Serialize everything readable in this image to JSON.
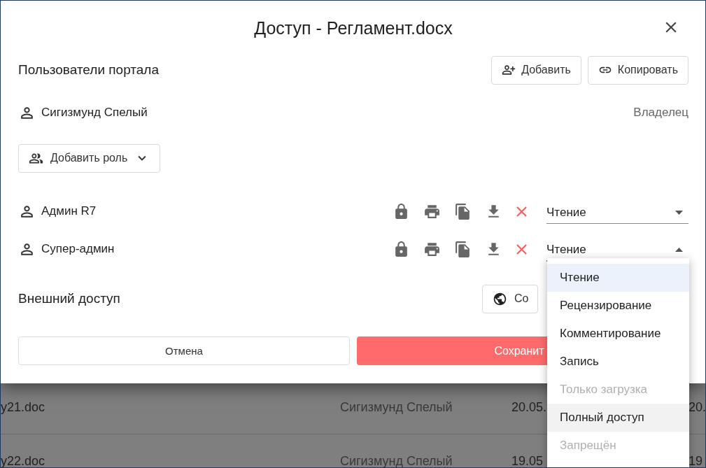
{
  "dialog": {
    "title": "Доступ - Регламент.docx"
  },
  "portal_users": {
    "label": "Пользователи портала",
    "buttons": [
      {
        "kind": "add",
        "label": "Добавить"
      },
      {
        "kind": "copy",
        "label": "Копировать"
      }
    ]
  },
  "owner": {
    "name": "Сигизмунд Спелый",
    "role": "Владелец"
  },
  "add_role_button": {
    "label": "Добавить роль"
  },
  "users": [
    {
      "name": "Админ R7",
      "permission": "Чтение",
      "expanded": false
    },
    {
      "name": "Супер-админ",
      "permission": "Чтение",
      "expanded": true
    }
  ],
  "external_access": {
    "label": "Внешний доступ",
    "button_label": "Со"
  },
  "footer": {
    "cancel": "Отмена",
    "save": "Сохранит"
  },
  "permission_menu": {
    "options": [
      {
        "label": "Чтение",
        "selected": true,
        "hovered": false,
        "disabled": false
      },
      {
        "label": "Рецензирование",
        "selected": false,
        "hovered": false,
        "disabled": false
      },
      {
        "label": "Комментирование",
        "selected": false,
        "hovered": false,
        "disabled": false
      },
      {
        "label": "Запись",
        "selected": false,
        "hovered": false,
        "disabled": false
      },
      {
        "label": "Только загрузка",
        "selected": false,
        "hovered": false,
        "disabled": true
      },
      {
        "label": "Полный доступ",
        "selected": false,
        "hovered": true,
        "disabled": false
      },
      {
        "label": "Запрещён",
        "selected": false,
        "hovered": false,
        "disabled": true
      }
    ]
  },
  "background_table": {
    "rows": [
      {
        "name": "y21.doc",
        "author": "Сигизмунд Спелый",
        "date": "20.05.",
        "date_2": "20."
      },
      {
        "name": "y22.doc",
        "author": "Сигизмунд Спелый",
        "date": "19.05",
        "date_2": "19"
      }
    ]
  }
}
